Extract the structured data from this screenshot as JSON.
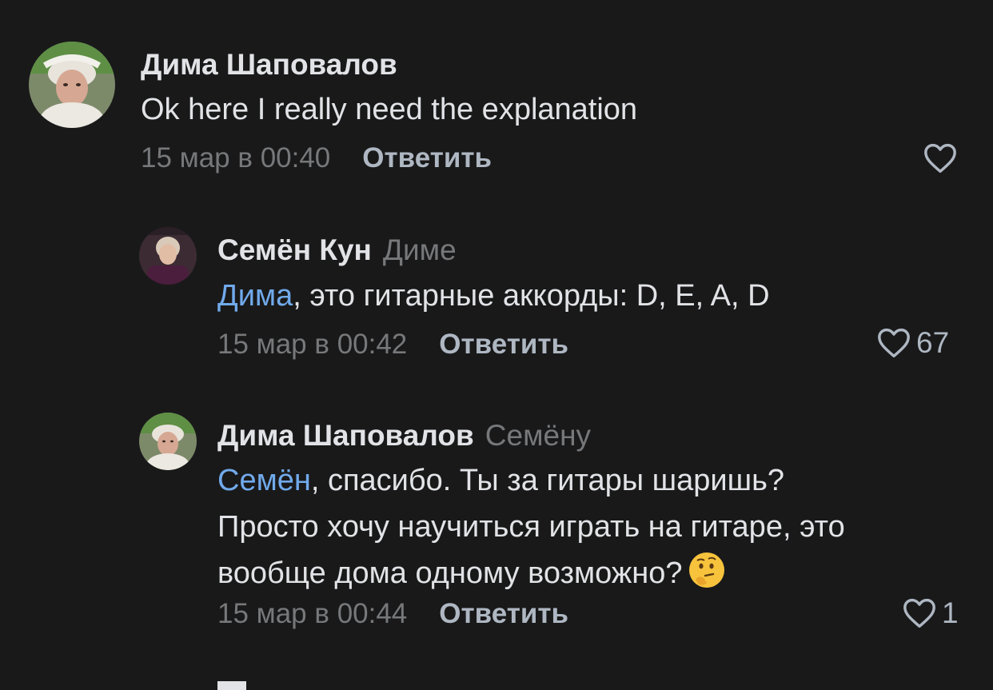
{
  "comments": [
    {
      "author": "Дима Шаповалов",
      "reply_to": "",
      "mention": "",
      "text": "Ok here I really need the explanation",
      "date": "15 мар в 00:40",
      "reply_label": "Ответить",
      "likes": "",
      "avatar_icon": "child-photo-avatar"
    },
    {
      "author": "Семён Кун",
      "reply_to": "Диме",
      "mention": "Дима",
      "text": ", это гитарные аккорды: D, E, A, D",
      "date": "15 мар в 00:42",
      "reply_label": "Ответить",
      "likes": "67",
      "avatar_icon": "person-photo-avatar"
    },
    {
      "author": "Дима Шаповалов",
      "reply_to": "Семёну",
      "mention": "Семён",
      "text_line1": ", спасибо. Ты за гитары шаришь?",
      "text_line2": "Просто хочу научиться играть на гитаре, это",
      "text_line3": "вообще дома одному  возможно?",
      "emoji": "thinking-face",
      "date": "15 мар в 00:44",
      "reply_label": "Ответить",
      "likes": "1",
      "avatar_icon": "child-photo-avatar"
    }
  ],
  "colors": {
    "background": "#19191a",
    "text": "#e1e3e6",
    "secondary": "#76787a",
    "mention": "#71aaeb",
    "action": "#aeb7c2"
  }
}
